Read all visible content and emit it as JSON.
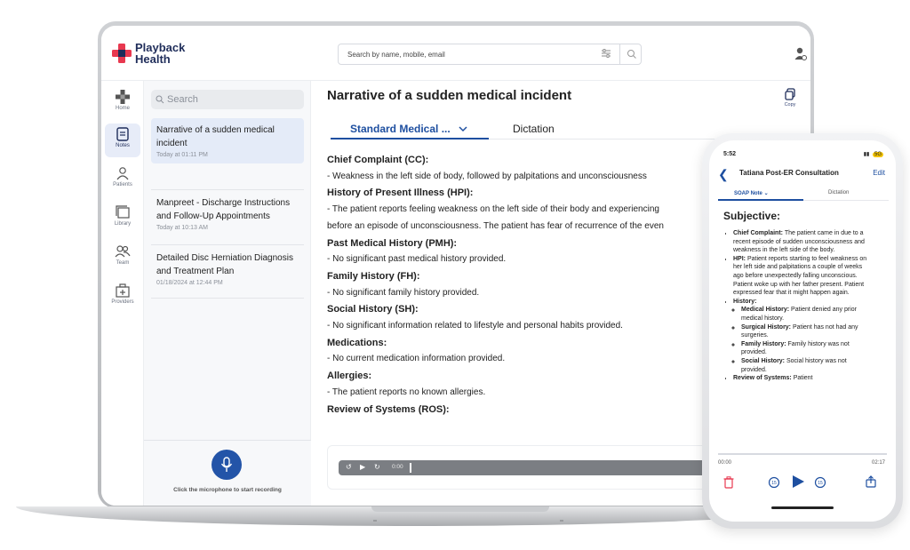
{
  "header": {
    "brand_line1": "Playback",
    "brand_line2": "Health",
    "search_placeholder": "Search by name, mobile, email"
  },
  "nav": {
    "items": [
      {
        "label": "Home",
        "icon": "home-icon"
      },
      {
        "label": "Notes",
        "icon": "notes-icon"
      },
      {
        "label": "Patients",
        "icon": "patients-icon"
      },
      {
        "label": "Library",
        "icon": "library-icon"
      },
      {
        "label": "Team",
        "icon": "team-icon"
      },
      {
        "label": "Providers",
        "icon": "providers-icon"
      }
    ]
  },
  "notes_list": {
    "search_placeholder": "Search",
    "notes": [
      {
        "title": "Narrative of a sudden medical incident",
        "time": "Today at 01:11 PM"
      },
      {
        "title": "Manpreet - Discharge Instructions and Follow-Up Appointments",
        "time": "Today at 10:13 AM"
      },
      {
        "title": "Detailed Disc Herniation Diagnosis and Treatment Plan",
        "time": "01/18/2024 at 12:44 PM"
      }
    ],
    "record_hint": "Click the microphone to start recording"
  },
  "note": {
    "title": "Narrative of a sudden medical incident",
    "copy_label": "Copy",
    "tabs": {
      "template": "Standard Medical ...",
      "dictation": "Dictation"
    },
    "lines": [
      {
        "text": "Chief Complaint (CC):",
        "heading": true
      },
      {
        "text": "- Weakness in the left side of body, followed by palpitations and unconsciousness",
        "heading": false
      },
      {
        "text": "History of Present Illness (HPI):",
        "heading": true
      },
      {
        "text": "- The patient reports feeling weakness on the left side of their body and experiencing",
        "heading": false
      },
      {
        "text": "before an episode of unconsciousness. The patient has fear of recurrence of the even",
        "heading": false
      },
      {
        "text": "Past Medical History (PMH):",
        "heading": true
      },
      {
        "text": "- No significant past medical history provided.",
        "heading": false
      },
      {
        "text": "Family History (FH):",
        "heading": true
      },
      {
        "text": "- No significant family history provided.",
        "heading": false
      },
      {
        "text": "Social History (SH):",
        "heading": true
      },
      {
        "text": "- No significant information related to lifestyle and personal habits provided.",
        "heading": false
      },
      {
        "text": "Medications:",
        "heading": true
      },
      {
        "text": "- No current medication information provided.",
        "heading": false
      },
      {
        "text": "Allergies:",
        "heading": true
      },
      {
        "text": "- The patient reports no known allergies.",
        "heading": false
      },
      {
        "text": "Review of Systems (ROS):",
        "heading": true
      }
    ],
    "player_time": "0:00"
  },
  "phone": {
    "time": "5:52",
    "status_right": "5G",
    "title": "Tatiana Post-ER Consultation",
    "edit": "Edit",
    "tab_note": "SOAP Note",
    "tab_dictation": "Dictation",
    "section": "Subjective:",
    "cc_label": "Chief Complaint:",
    "cc_text": " The patient came in due to a recent episode of sudden unconsciousness and weakness in the left side of the body.",
    "hpi_label": "HPI:",
    "hpi_text": " Patient reports starting to feel weakness on her left side and palpitations a couple of weeks ago before unexpectedly falling unconscious. Patient woke up with her father present. Patient expressed fear that it might happen again.",
    "history_label": "History:",
    "mh_label": "Medical History:",
    "mh_text": " Patient denied any prior medical history.",
    "sh_label": "Surgical History:",
    "sh_text": " Patient has not had any surgeries.",
    "fh_label": "Family History:",
    "fh_text": " Family history was not provided.",
    "soc_label": "Social History:",
    "soc_text": " Social history was not provided.",
    "ros_label": "Review of Systems:",
    "ros_text": " Patient",
    "time_start": "00:00",
    "time_end": "02:17"
  },
  "colors": {
    "accent": "#1e4fa0",
    "brand_red": "#e8384f",
    "brand_navy": "#1f2d5a"
  }
}
